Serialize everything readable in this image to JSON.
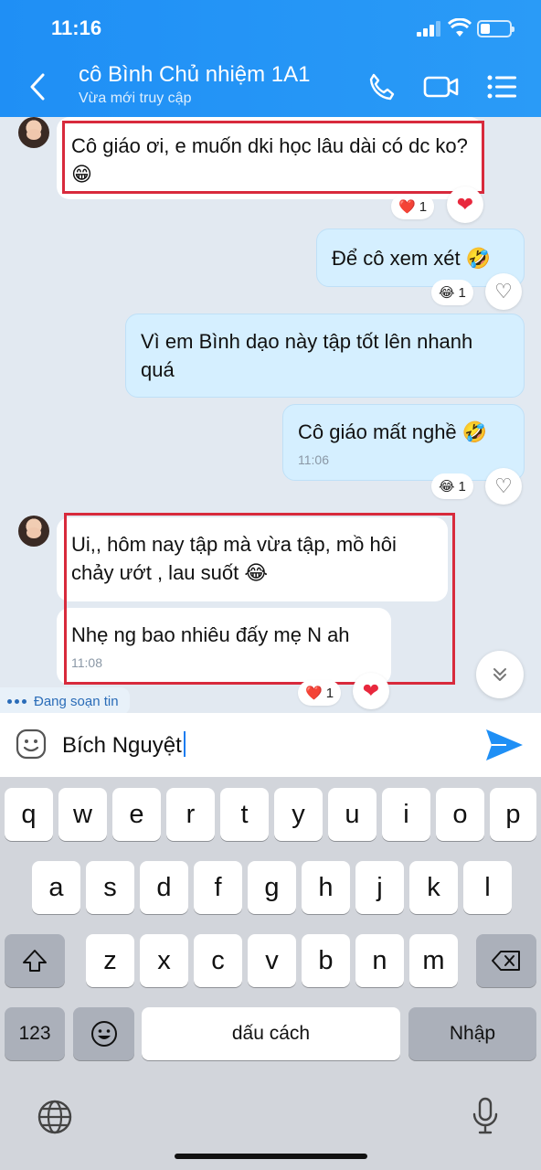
{
  "status_bar": {
    "time": "11:16"
  },
  "header": {
    "title": "cô Bình Chủ nhiệm 1A1",
    "subtitle": "Vừa mới truy cập",
    "icons": [
      "back-icon",
      "phone-icon",
      "video-call-icon",
      "menu-list-icon"
    ]
  },
  "messages": [
    {
      "side": "in",
      "text": "Cô giáo ơi, e muốn dki học lâu dài có dc ko? 😁",
      "reaction_emoji": "❤️",
      "reaction_count": "1"
    },
    {
      "side": "out",
      "text": "Để cô xem xét 🤣",
      "reaction_emoji": "😂",
      "reaction_count": "1"
    },
    {
      "side": "out",
      "text": "Vì em Bình dạo này tập tốt lên nhanh quá"
    },
    {
      "side": "out",
      "text": "Cô giáo mất nghề 🤣",
      "time": "11:06",
      "reaction_emoji": "😂",
      "reaction_count": "1"
    },
    {
      "side": "in",
      "text": "Ui,, hôm nay tập mà vừa tập, mồ hôi chảy ướt , lau suốt 😂"
    },
    {
      "side": "in",
      "text": "Nhẹ ng bao nhiêu đấy mẹ N ah",
      "time": "11:08",
      "reaction_emoji": "❤️",
      "reaction_count": "1"
    }
  ],
  "typing_indicator": "Đang soạn tin",
  "composer": {
    "value": "Bích Nguyệt"
  },
  "keyboard": {
    "row1": [
      "q",
      "w",
      "e",
      "r",
      "t",
      "y",
      "u",
      "i",
      "o",
      "p"
    ],
    "row2": [
      "a",
      "s",
      "d",
      "f",
      "g",
      "h",
      "j",
      "k",
      "l"
    ],
    "row3": [
      "z",
      "x",
      "c",
      "v",
      "b",
      "n",
      "m"
    ],
    "numbers_key": "123",
    "space_key": "dấu cách",
    "return_key": "Nhập"
  },
  "colors": {
    "header": "#2196f3",
    "highlight": "#d82a3c",
    "outgoing_bubble": "#d5efff"
  }
}
